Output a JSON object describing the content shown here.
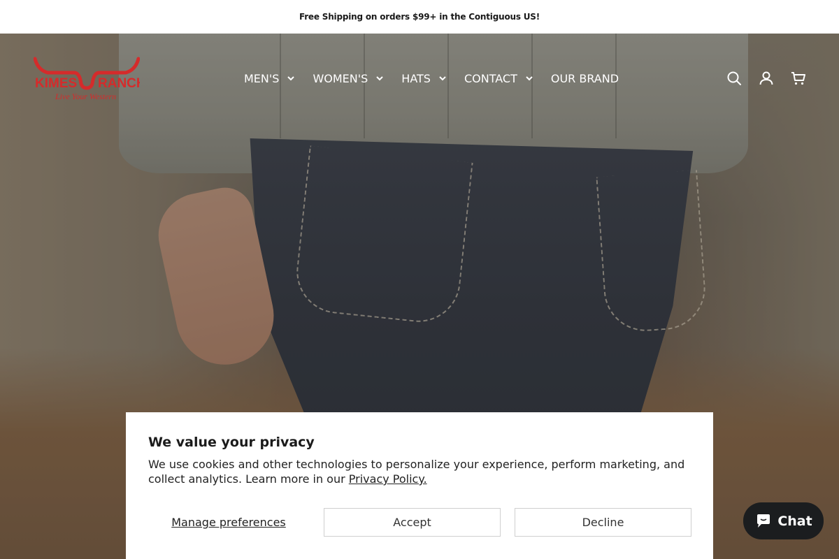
{
  "announcement": "Free Shipping on orders $99+ in the Contiguous US!",
  "brand": {
    "name_left": "KIMES",
    "name_right": "RANCH",
    "tagline": "Live Your Western",
    "color": "#d52b2b"
  },
  "nav": {
    "items": [
      {
        "label": "MEN'S",
        "dropdown": true
      },
      {
        "label": "WOMEN'S",
        "dropdown": true
      },
      {
        "label": "HATS",
        "dropdown": true
      },
      {
        "label": "CONTACT",
        "dropdown": true
      },
      {
        "label": "OUR BRAND",
        "dropdown": false
      }
    ]
  },
  "header_icons": [
    "search-icon",
    "account-icon",
    "cart-icon"
  ],
  "privacy": {
    "title": "We value your privacy",
    "body": "We use cookies and other technologies to personalize your experience, perform marketing, and collect analytics. Learn more in our",
    "link": "Privacy Policy.",
    "manage_label": "Manage preferences",
    "accept_label": "Accept",
    "decline_label": "Decline"
  },
  "chat": {
    "label": "Chat",
    "icon": "chat-bubble-icon"
  }
}
